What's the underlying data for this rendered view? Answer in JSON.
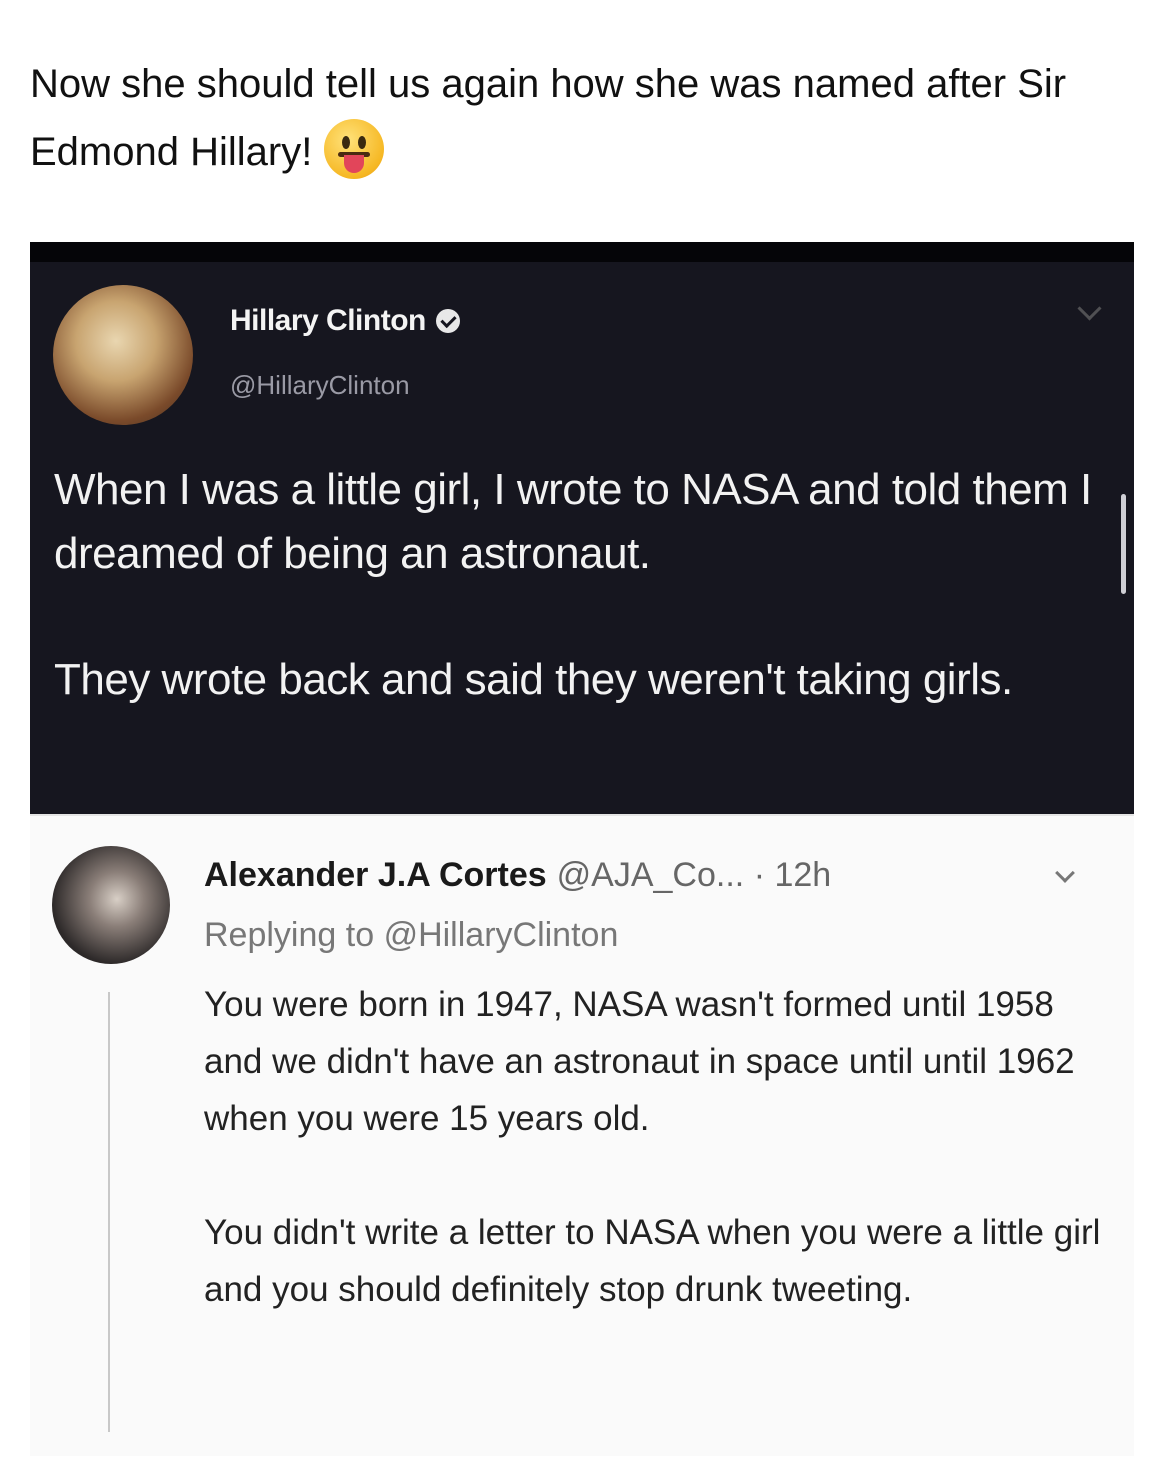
{
  "caption": {
    "text": "Now she should tell us again how she was named after Sir Edmond Hillary!",
    "emoji": "face-with-tongue-emoji"
  },
  "tweet": {
    "author_name": "Hillary Clinton",
    "verified_icon": "verified-badge-icon",
    "handle": "@HillaryClinton",
    "paragraphs": [
      "When I was a little girl, I wrote to NASA and told them I dreamed of being an astronaut.",
      "They wrote back and said they weren't taking girls."
    ],
    "theme_colors": {
      "background": "#16161f",
      "text": "#f2f2f2"
    }
  },
  "reply": {
    "author_name": "Alexander J.A Cortes",
    "handle": "@AJA_Co...",
    "separator": "·",
    "time": "12h",
    "replying_prefix": "Replying to",
    "replying_to": "@HillaryClinton",
    "paragraphs": [
      "You were born in 1947, NASA wasn't formed until 1958 and we didn't have an astronaut in space until until 1962 when you were 15 years old.",
      "You didn't write a letter to NASA when you were a little girl and you should definitely stop drunk tweeting."
    ]
  }
}
